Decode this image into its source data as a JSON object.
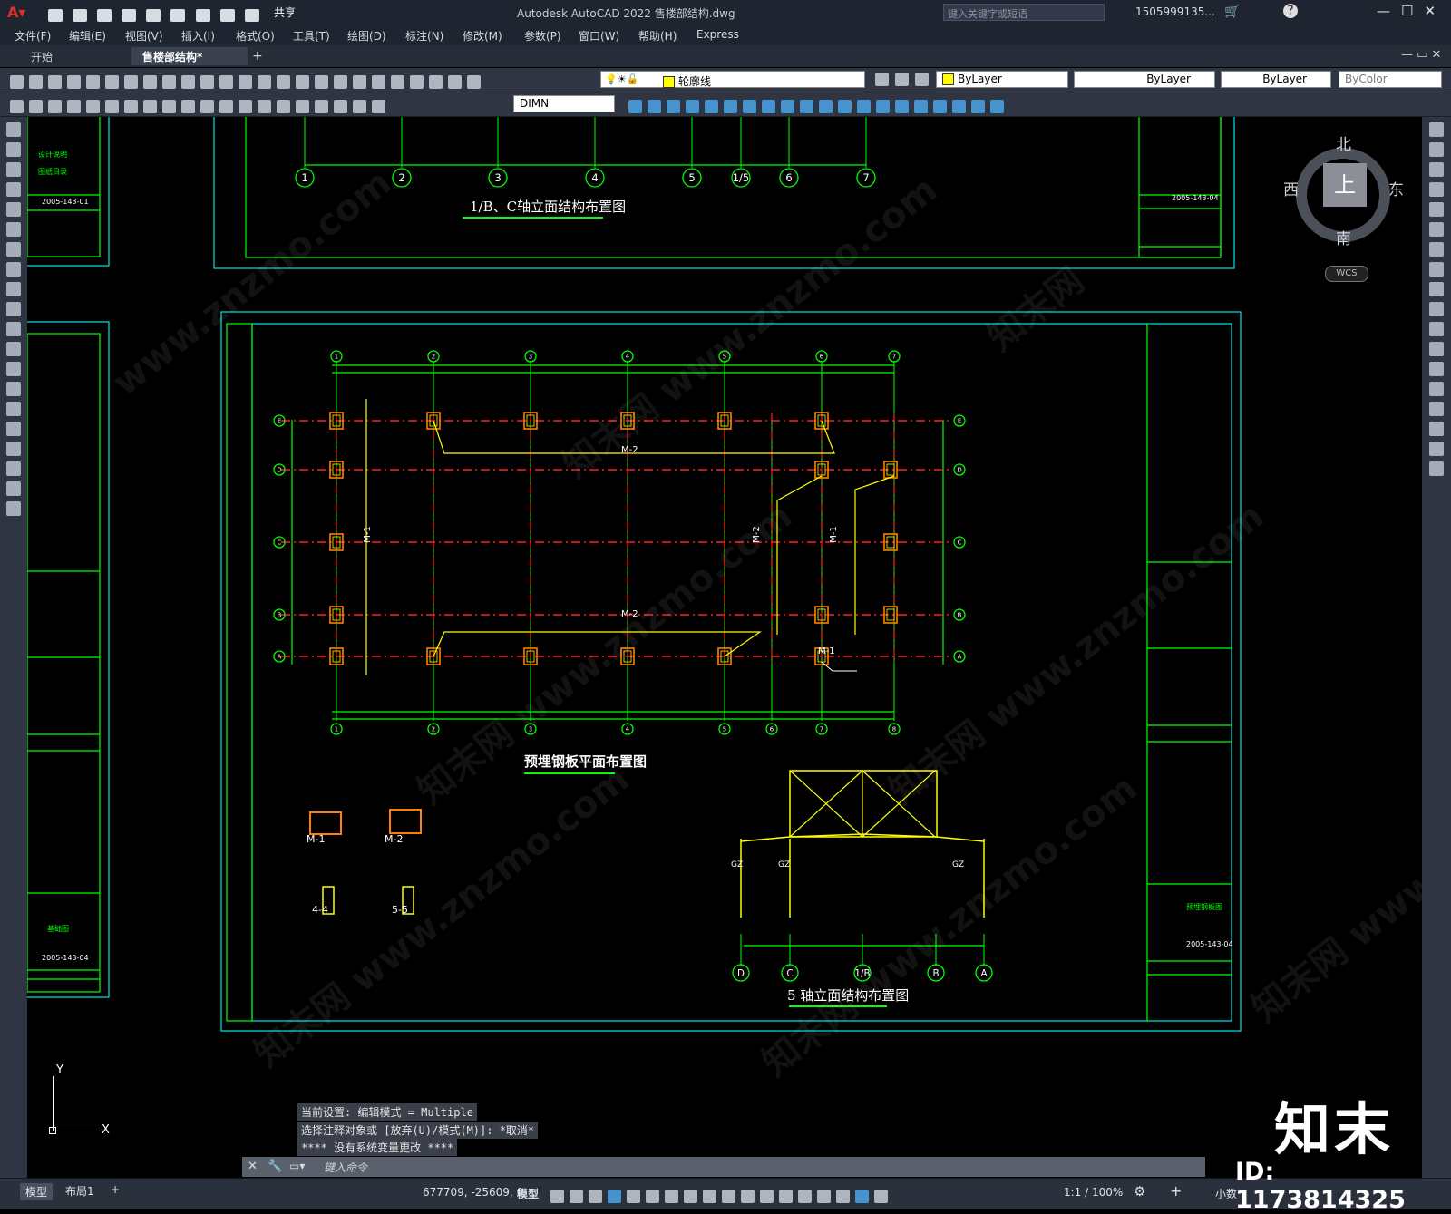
{
  "window": {
    "title": "Autodesk AutoCAD 2022    售楼部结构.dwg",
    "share_label": "共享",
    "search_placeholder": "键入关键字或短语",
    "user": "1505999135...",
    "controls": [
      "—",
      "☐",
      "✕"
    ]
  },
  "menu": [
    "文件(F)",
    "编辑(E)",
    "视图(V)",
    "插入(I)",
    "格式(O)",
    "工具(T)",
    "绘图(D)",
    "标注(N)",
    "修改(M)",
    "参数(P)",
    "窗口(W)",
    "帮助(H)",
    "Express"
  ],
  "tabs": [
    {
      "label": "开始",
      "active": false
    },
    {
      "label": "售楼部结构*",
      "active": true
    }
  ],
  "toolbar": {
    "layer_name": "轮廓线",
    "color": "ByLayer",
    "linetype": "ByLayer",
    "lineweight": "ByLayer",
    "plotstyle": "ByColor",
    "dimstyle": "DIMN"
  },
  "viewcube": {
    "north": "北",
    "south": "南",
    "east": "东",
    "west": "西",
    "top": "上",
    "wcs": "WCS"
  },
  "drawing": {
    "sheet1_title": "1/B、C轴立面结构布置图",
    "sheet1_axes": [
      "1",
      "2",
      "3",
      "4",
      "5",
      "1/5",
      "6",
      "7"
    ],
    "plan_title": "预埋钢板平面布置图",
    "plan_top_axes": [
      "1",
      "2",
      "3",
      "4",
      "5",
      "6",
      "7"
    ],
    "plan_bottom_axes": [
      "1",
      "2",
      "3",
      "4",
      "5",
      "6",
      "7",
      "8"
    ],
    "plan_row_axes": [
      "E",
      "D",
      "C",
      "B",
      "A"
    ],
    "plate_labels": [
      "M-2",
      "M-2",
      "M-1",
      "M-1",
      "M-2",
      "M-1"
    ],
    "detail_labels": [
      "M-1",
      "M-2",
      "4-4",
      "5-5"
    ],
    "elev_title": "5 轴立面结构布置图",
    "elev_axes": [
      "D",
      "C",
      "1/B",
      "B",
      "A"
    ],
    "elev_columns": [
      "GZ",
      "GZ",
      "GZ"
    ],
    "titleblock_no": "2005-143-04",
    "titleblock_no_left": "2005-143-01",
    "left_label_1": "设计说明",
    "left_label_2": "图纸目录",
    "left_label_3": "基础图",
    "tb_sheet_name": "预埋钢板图"
  },
  "command": {
    "history": [
      "当前设置: 编辑模式 = Multiple",
      "选择注释对象或 [放弃(U)/模式(M)]: *取消*",
      "**** 没有系统变量更改 ****"
    ],
    "placeholder": "键入命令"
  },
  "layout_tabs": [
    "模型",
    "布局1",
    "+"
  ],
  "status": {
    "coords": "677709, -25609, 0",
    "mode": "模型",
    "scale": "1:1 / 100%",
    "units": "小数"
  },
  "watermark": {
    "brand": "知末",
    "id": "ID: 1173814325",
    "site": "www.znzmo.com"
  },
  "colors": {
    "frame": "#00e5e5",
    "grid_green": "#00ff00",
    "axis_red": "#ff2020",
    "yellow": "#ffff00",
    "orange": "#ff8000"
  }
}
